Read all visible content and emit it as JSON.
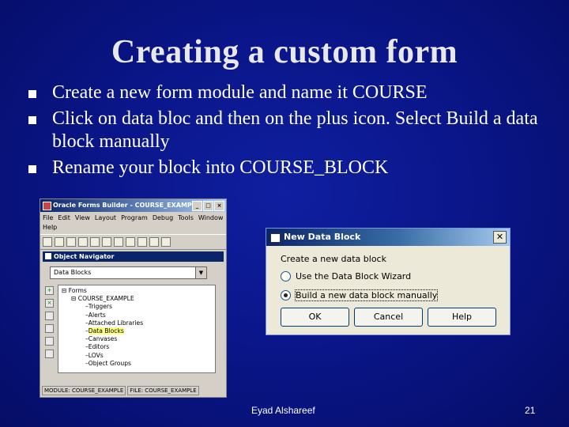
{
  "slide": {
    "title": "Creating a custom form",
    "bullets": [
      "Create a new form module and name it COURSE",
      "Click on data bloc and then on the plus icon. Select Build a data block manually",
      "Rename your block into COURSE_BLOCK"
    ],
    "footer_author": "Eyad Alshareef",
    "page_number": "21"
  },
  "forms_builder": {
    "title": "Oracle Forms Builder - COURSE_EXAMPLE",
    "menu": [
      "File",
      "Edit",
      "View",
      "Layout",
      "Program",
      "Debug",
      "Tools",
      "Window",
      "Help"
    ],
    "navigator_title": "Object Navigator",
    "combo_value": "Data Blocks",
    "tree": {
      "root": "Forms",
      "module": "COURSE_EXAMPLE",
      "nodes": [
        "Triggers",
        "Alerts",
        "Attached Libraries",
        "Data Blocks",
        "Canvases",
        "Editors",
        "LOVs",
        "Object Groups"
      ],
      "selected": "Data Blocks"
    },
    "status": [
      "MODULE: COURSE_EXAMPLE",
      "FILE: COURSE_EXAMPLE"
    ]
  },
  "dialog": {
    "title": "New Data Block",
    "caption": "Create a new data block",
    "options": [
      "Use the Data Block Wizard",
      "Build a new data block manually"
    ],
    "selected_option": 1,
    "buttons": {
      "ok": "OK",
      "cancel": "Cancel",
      "help": "Help"
    }
  },
  "colors": {
    "background": "#0a168a",
    "text": "#ffffff",
    "dialog_bg": "#ece9d8",
    "titlebar": "#0a246a"
  }
}
